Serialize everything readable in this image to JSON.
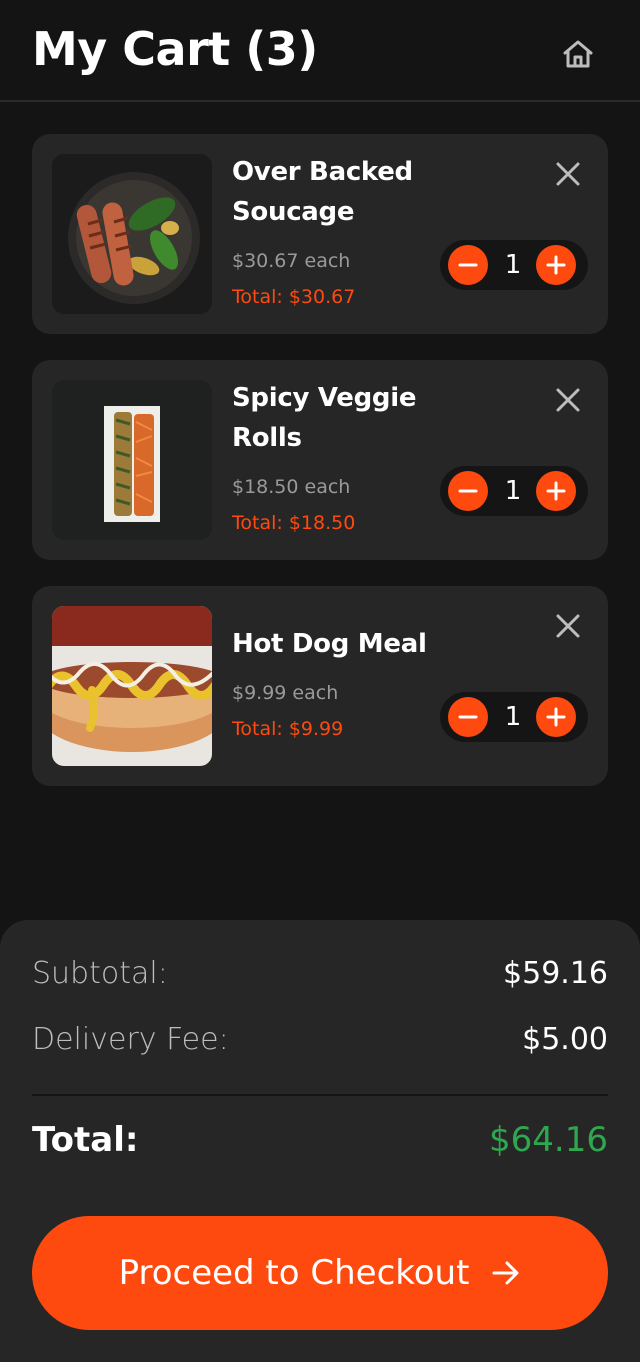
{
  "header": {
    "title": "My Cart (3)",
    "home_icon": "home-icon"
  },
  "cart": {
    "items": [
      {
        "name": "Over Backed Soucage",
        "price_each": "$30.67 each",
        "total": "Total: $30.67",
        "quantity": "1",
        "image": "sausage-plate-photo"
      },
      {
        "name": "Spicy Veggie Rolls",
        "price_each": "$18.50 each",
        "total": "Total: $18.50",
        "quantity": "1",
        "image": "veggie-rolls-photo"
      },
      {
        "name": "Hot Dog Meal",
        "price_each": "$9.99 each",
        "total": "Total: $9.99",
        "quantity": "1",
        "image": "hot-dog-photo"
      }
    ]
  },
  "summary": {
    "subtotal_label": "Subtotal:",
    "subtotal_value": "$59.16",
    "delivery_label": "Delivery Fee:",
    "delivery_value": "$5.00",
    "total_label": "Total:",
    "total_value": "$64.16"
  },
  "checkout": {
    "label": "Proceed to Checkout"
  },
  "colors": {
    "accent": "#ff4a0f",
    "background": "#141414",
    "card": "#262626",
    "total_green": "#2ea84f"
  }
}
